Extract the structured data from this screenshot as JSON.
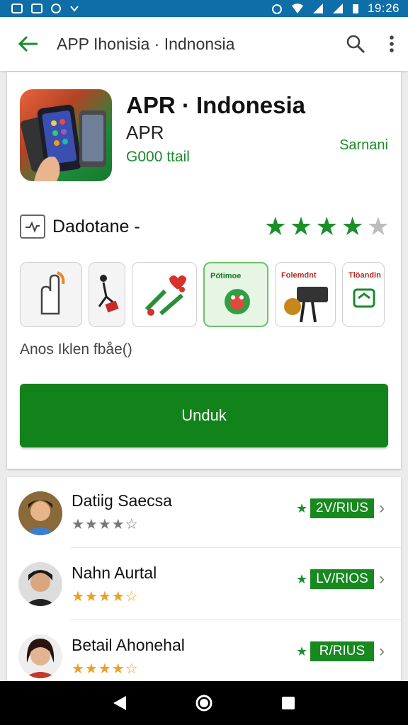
{
  "status_bar": {
    "time": "19:26"
  },
  "app_bar": {
    "title": "APP Ihonisia · Indnonsia"
  },
  "app": {
    "name": "APR · Indonesia",
    "developer": "APR",
    "installs": "G000 ttail",
    "side_label": "Sarnani",
    "rating_label": "Dadotane -",
    "rating_stars": 4,
    "screenshots": [
      {
        "caption": ""
      },
      {
        "caption": ""
      },
      {
        "caption": ""
      },
      {
        "caption": "Pötimoe"
      },
      {
        "caption": "Folemdnt"
      },
      {
        "caption": "Tlöandin"
      }
    ],
    "description": "Anos Iklen fbåe()",
    "install_label": "Unduk"
  },
  "reviews": [
    {
      "name": "Datiig Saecsa",
      "stars": "★★★★☆",
      "badge": "2V/RIUS"
    },
    {
      "name": "Nahn Aurtal",
      "stars": "★★★★☆",
      "badge": "LV/RIOS"
    },
    {
      "name": "Betail Ahonehal",
      "stars": "★★★★☆",
      "badge": "R/RIUS"
    }
  ],
  "icons": {
    "back": "arrow-back-icon",
    "search": "search-icon",
    "more": "more-vert-icon",
    "nav_back": "triangle-back-icon",
    "nav_home": "circle-home-icon",
    "nav_recents": "square-recents-icon"
  },
  "colors": {
    "status_bar": "#0e6ea8",
    "accent_green": "#12831a",
    "star_green": "#1a8f2a",
    "star_gold": "#e8a22b"
  }
}
